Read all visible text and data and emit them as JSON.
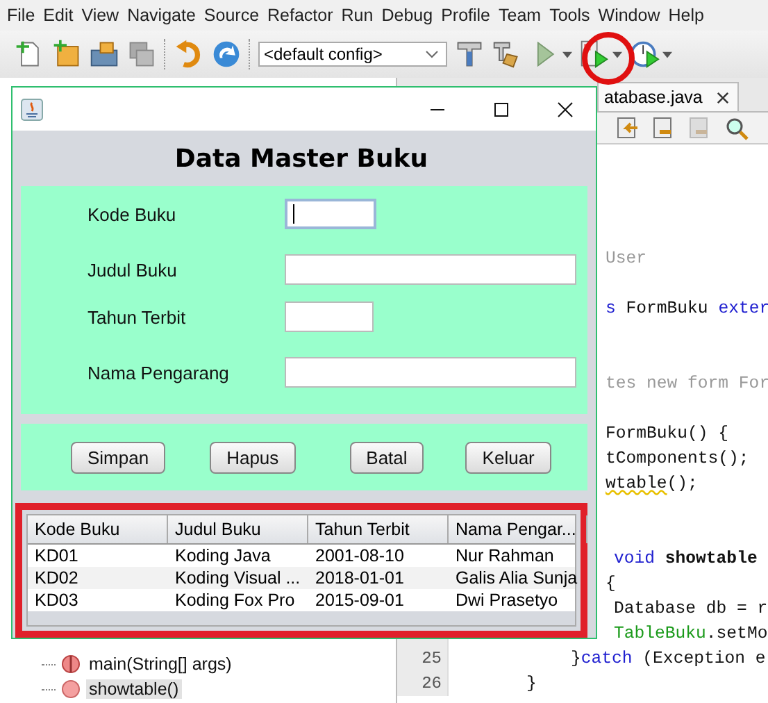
{
  "menu": [
    {
      "label": "File"
    },
    {
      "label": "Edit"
    },
    {
      "label": "View"
    },
    {
      "label": "Navigate"
    },
    {
      "label": "Source"
    },
    {
      "label": "Refactor"
    },
    {
      "label": "Run"
    },
    {
      "label": "Debug"
    },
    {
      "label": "Profile"
    },
    {
      "label": "Team"
    },
    {
      "label": "Tools"
    },
    {
      "label": "Window"
    },
    {
      "label": "Help"
    }
  ],
  "toolbar": {
    "config": "<default config>"
  },
  "editor": {
    "tab": "atabase.java",
    "code": [
      {
        "segments": [
          {
            "text": "User",
            "kind": "comment"
          }
        ]
      },
      {
        "segments": [
          {
            "text": "s",
            "kind": "keyword"
          },
          {
            "text": " FormBuku ",
            "kind": "plain"
          },
          {
            "text": "exter",
            "kind": "keyword"
          }
        ]
      },
      {
        "segments": [
          {
            "text": "tes new form For",
            "kind": "comment"
          }
        ]
      },
      {
        "segments": [
          {
            "text": "FormBuku() {",
            "kind": "plain"
          }
        ]
      },
      {
        "segments": [
          {
            "text": "tComponents();",
            "kind": "plain"
          }
        ]
      },
      {
        "segments": [
          {
            "text": "wtable",
            "kind": "warning"
          },
          {
            "text": "();",
            "kind": "plain"
          }
        ]
      },
      {
        "segments": [
          {
            "text": "void",
            "kind": "keyword"
          },
          {
            "text": " showtable",
            "kind": "bold"
          }
        ]
      },
      {
        "segments": [
          {
            "text": "{",
            "kind": "plain"
          }
        ]
      },
      {
        "segments": [
          {
            "text": "Database db = r",
            "kind": "plain"
          }
        ]
      },
      {
        "segments": [
          {
            "text": "TableBuku",
            "kind": "field"
          },
          {
            "text": ".setMo",
            "kind": "plain"
          }
        ]
      },
      {
        "number": "25",
        "segments": [
          {
            "text": "}",
            "kind": "plain"
          },
          {
            "text": "catch",
            "kind": "keyword"
          },
          {
            "text": " (Exception e",
            "kind": "plain"
          }
        ]
      },
      {
        "number": "26",
        "segments": [
          {
            "text": "}",
            "kind": "plain"
          }
        ]
      }
    ]
  },
  "navigator": {
    "items": [
      {
        "label": "main(String[] args)",
        "kind": "static",
        "selected": false
      },
      {
        "label": "showtable()",
        "kind": "private",
        "selected": true
      }
    ]
  },
  "dialog": {
    "heading": "Data Master Buku",
    "fields": [
      {
        "label": "Kode Buku",
        "focused": true
      },
      {
        "label": "Judul Buku",
        "focused": false
      },
      {
        "label": "Tahun Terbit",
        "focused": false
      },
      {
        "label": "Nama Pengarang",
        "focused": false
      }
    ],
    "buttons": [
      "Simpan",
      "Hapus",
      "Batal",
      "Keluar"
    ],
    "table": {
      "columns": [
        "Kode Buku",
        "Judul Buku",
        "Tahun Terbit",
        "Nama Pengar..."
      ],
      "rows": [
        [
          "KD01",
          "Koding Java",
          "2001-08-10",
          "Nur Rahman"
        ],
        [
          "KD02",
          "Koding Visual ...",
          "2018-01-01",
          "Galis Alia Sunja"
        ],
        [
          "KD03",
          "Koding Fox Pro",
          "2015-09-01",
          "Dwi Prasetyo"
        ]
      ]
    }
  }
}
